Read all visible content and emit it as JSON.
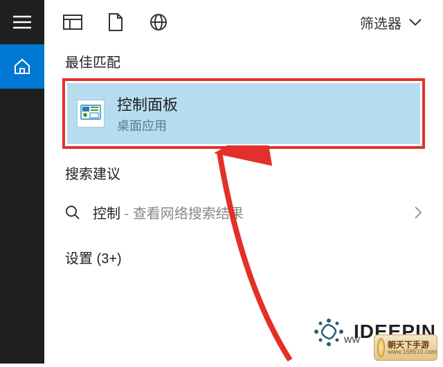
{
  "toolbar": {
    "filter_label": "筛选器"
  },
  "sections": {
    "best_match_label": "最佳匹配",
    "search_suggestions_label": "搜索建议",
    "settings_label": "设置 (3+)"
  },
  "best_match": {
    "title": "控制面板",
    "subtitle": "桌面应用"
  },
  "search": {
    "keyword": "控制",
    "hint": " - 查看网络搜索结果"
  },
  "watermark": {
    "brand": "IDEEPIN",
    "prefix": "ww",
    "badge_line1": "朝天下手游",
    "badge_line2": "www.168510.com"
  },
  "colors": {
    "highlight_border": "#e4302a",
    "selection_bg": "#b6dcf0",
    "accent": "#0078d4"
  }
}
